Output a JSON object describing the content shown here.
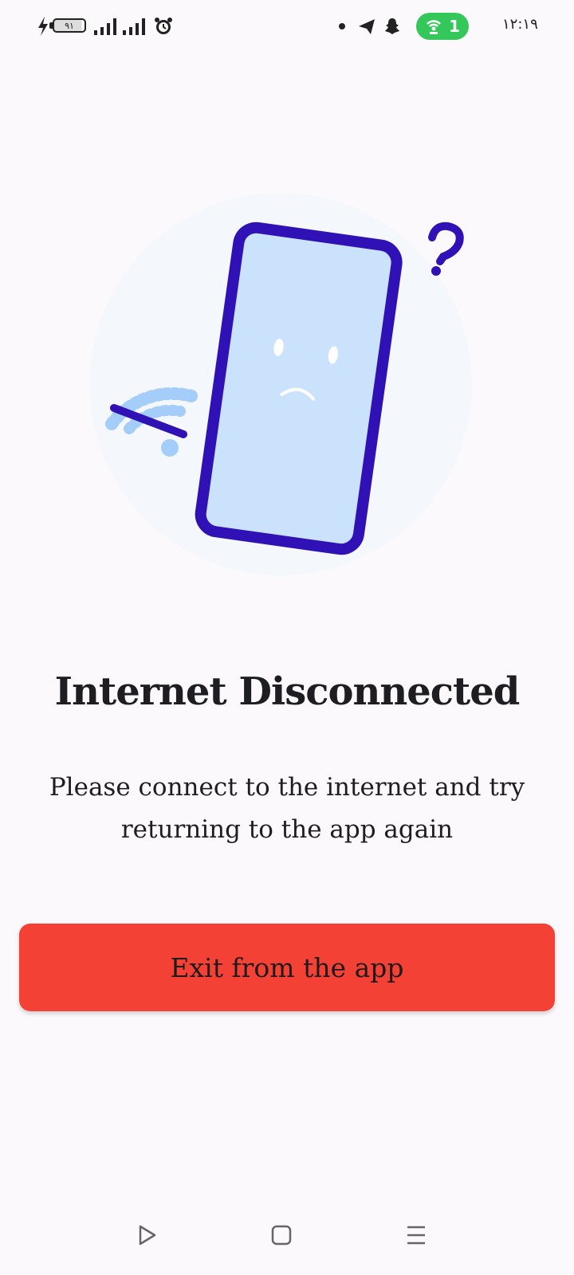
{
  "status_bar": {
    "battery_level": "۹۱",
    "hotspot_count": "1",
    "time": "۱۲:۱۹"
  },
  "colors": {
    "accent_purple": "#3011b5",
    "phone_screen": "#cae2fb",
    "wifi_blue": "#a5cdf9",
    "button_red": "#f44136",
    "hotspot_green": "#34c759"
  },
  "main": {
    "title": "Internet Disconnected",
    "message_line1": "Please connect to the internet and try",
    "message_line2": "returning to the app again",
    "exit_button_label": "Exit from the app"
  },
  "nav_bar": {
    "icons": [
      "back-triangle-icon",
      "home-square-icon",
      "recents-lines-icon"
    ]
  }
}
